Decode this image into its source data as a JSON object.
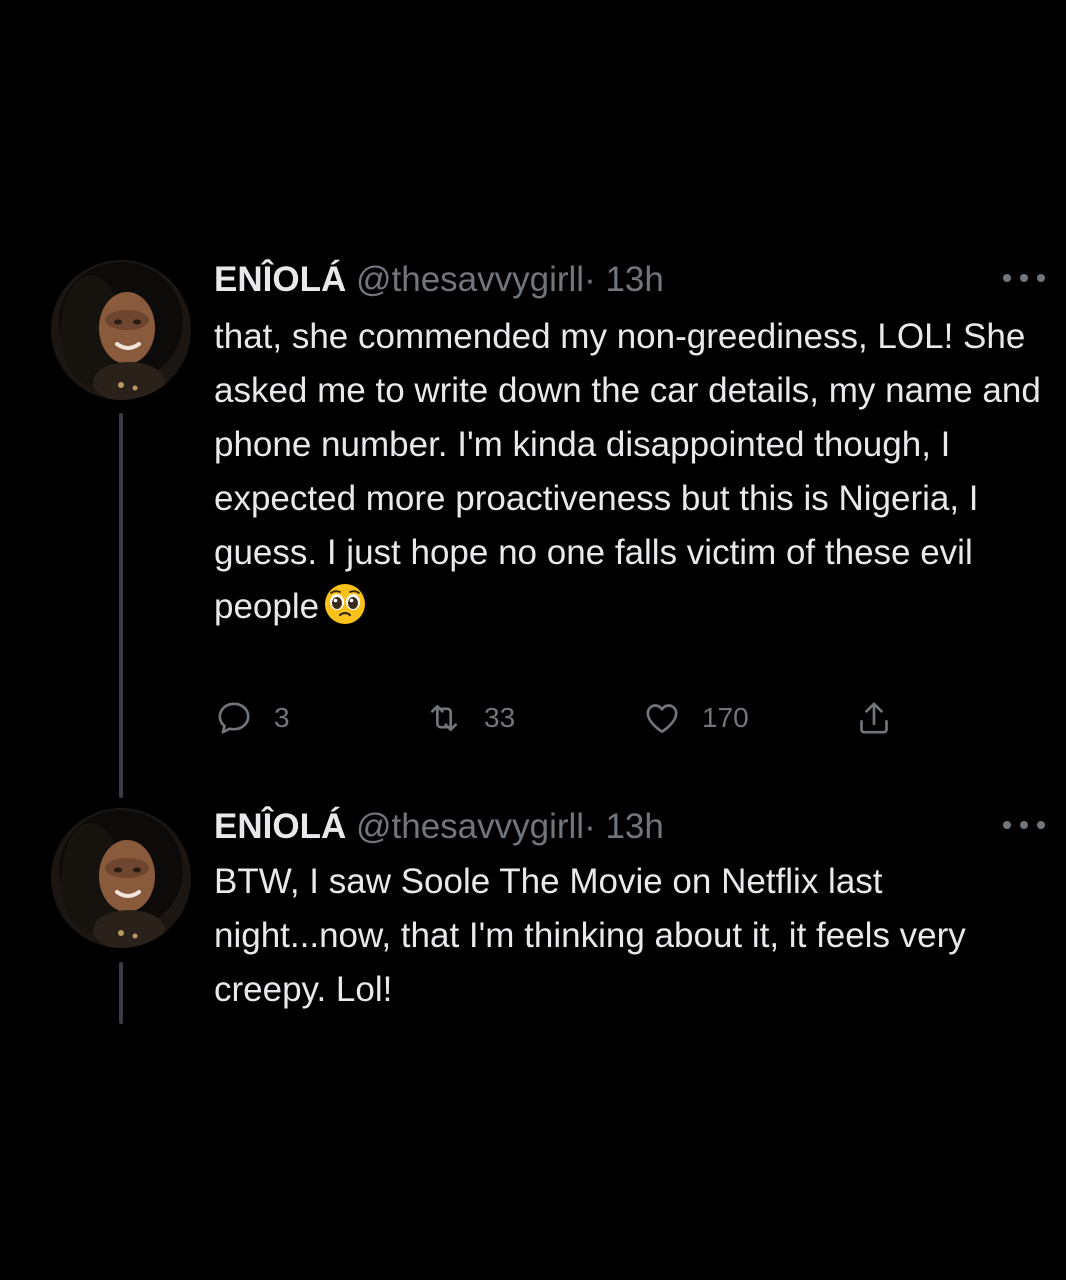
{
  "tweets": [
    {
      "display_name": "ENÎOLÁ",
      "handle": "@thesavvygirll",
      "separator": "·",
      "time": "13h",
      "text_before_emoji": "that, she commended my non-greediness, LOL! She asked me to write down the car details, my name and phone number. I'm kinda disappointed though, I expected more proactiveness but this is Nigeria, I guess. I just hope no one falls victim of these evil people",
      "emoji": "🥺",
      "replies": "3",
      "retweets": "33",
      "likes": "170"
    },
    {
      "display_name": "ENÎOLÁ",
      "handle": "@thesavvygirll",
      "separator": "·",
      "time": "13h",
      "text": "BTW, I saw Soole The Movie on Netflix last night...now, that I'm thinking about it, it feels very creepy. Lol!"
    }
  ],
  "icons": {
    "reply": "reply-icon",
    "retweet": "retweet-icon",
    "like": "like-icon",
    "share": "share-icon",
    "more": "more-icon"
  },
  "colors": {
    "background": "#000000",
    "primary_text": "#e7e9ea",
    "secondary_text": "#71767b",
    "thread_line": "#3a3d41"
  }
}
